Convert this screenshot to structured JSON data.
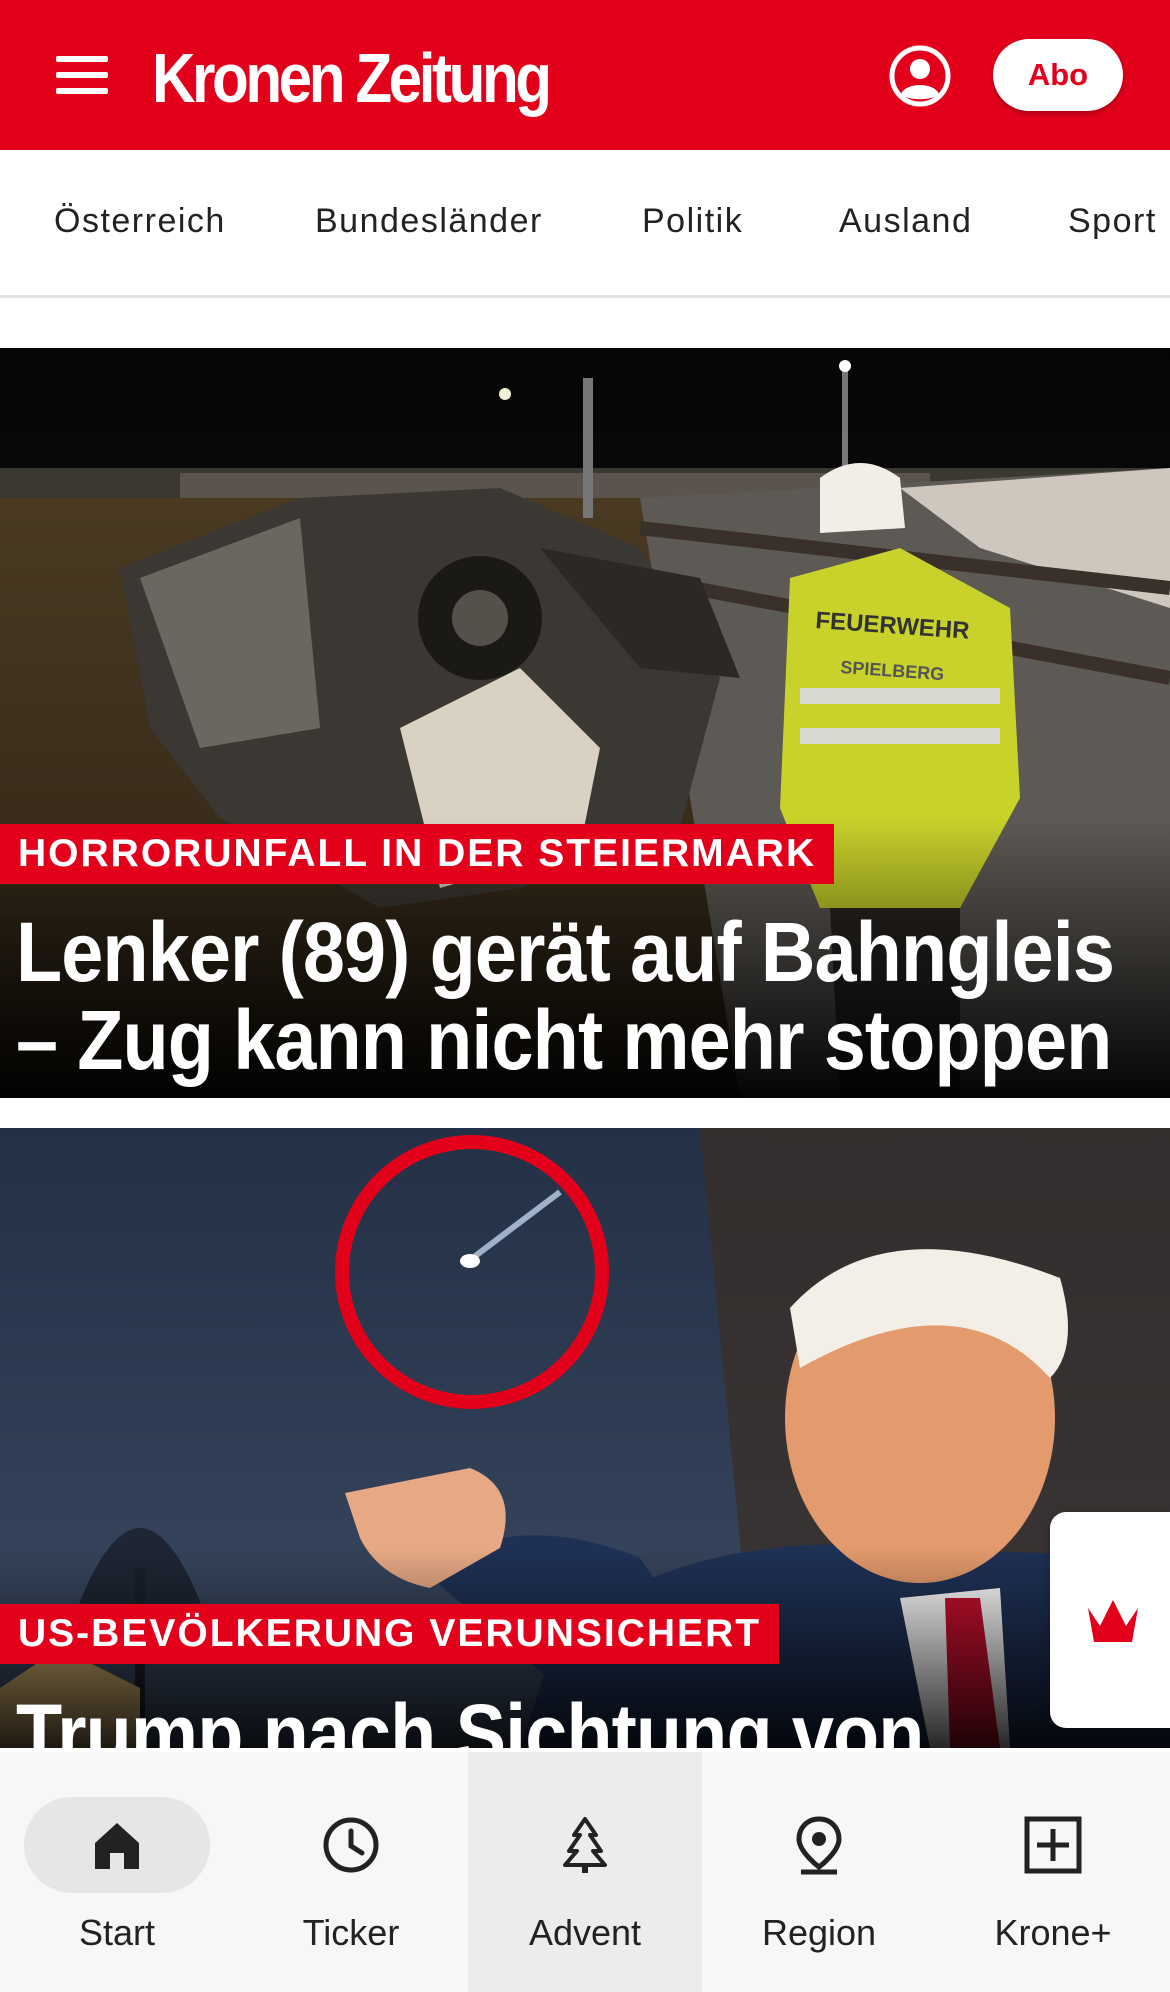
{
  "header": {
    "logo_text": "Kronen Zeitung",
    "abo_label": "Abo",
    "brand_color": "#e3001b",
    "menu_icon": "hamburger-menu-icon",
    "account_icon": "account-icon"
  },
  "nav": {
    "items": [
      "Österreich",
      "Bundesländer",
      "Politik",
      "Ausland",
      "Sport"
    ]
  },
  "articles": [
    {
      "kicker": "HORRORUNFALL IN DER STEIERMARK",
      "headline_line1": "Lenker (89) gerät auf Bahngleis",
      "headline_line2": "– Zug kann nicht mehr stoppen",
      "image_text": "FEUERWEHR",
      "image_text2": "SPIELBERG"
    },
    {
      "kicker": "US-BEVÖLKERUNG VERUNSICHERT",
      "headline_line1": "Trump nach Sichtung von"
    }
  ],
  "side_widget": {
    "icon": "krone-crown-icon"
  },
  "bottom_nav": {
    "items": [
      {
        "label": "Start",
        "icon": "home-icon",
        "active": true
      },
      {
        "label": "Ticker",
        "icon": "clock-icon"
      },
      {
        "label": "Advent",
        "icon": "tree-icon"
      },
      {
        "label": "Region",
        "icon": "location-pin-icon"
      },
      {
        "label": "Krone+",
        "icon": "plus-box-icon"
      }
    ]
  }
}
